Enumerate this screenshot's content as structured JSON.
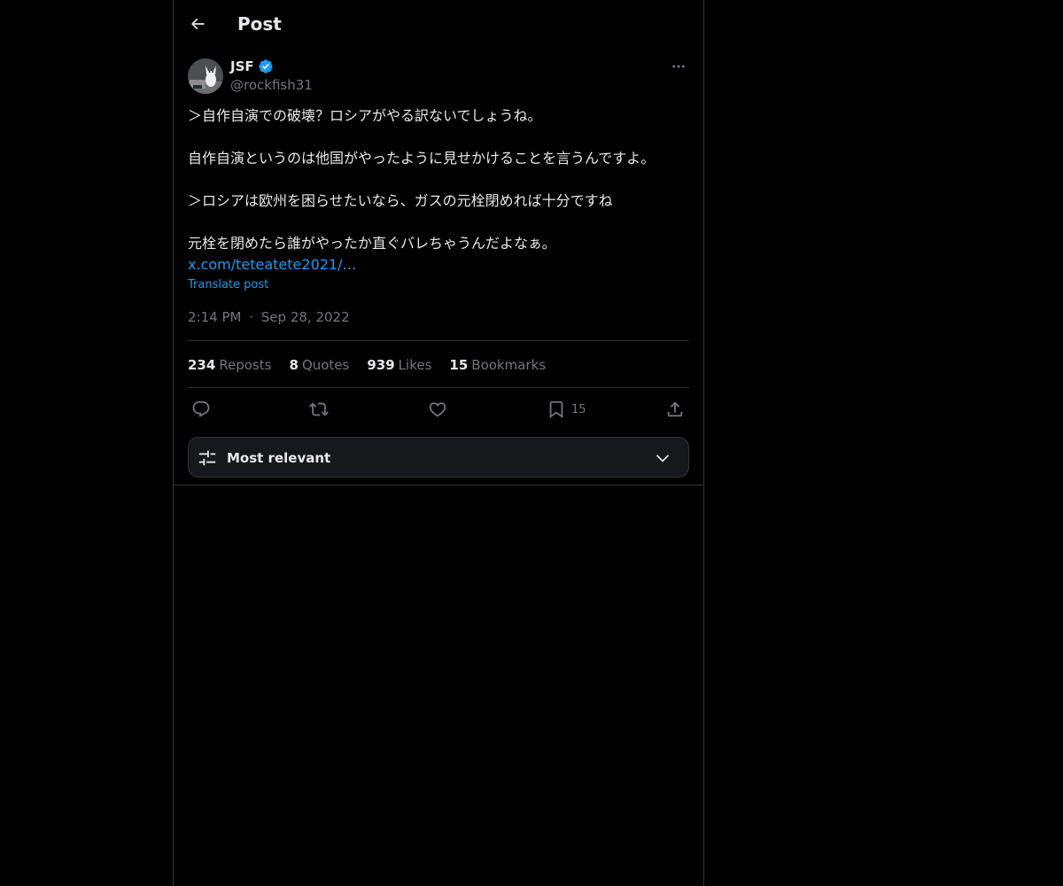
{
  "header": {
    "title": "Post",
    "back_icon": "arrow-left-icon"
  },
  "author": {
    "display_name": "JSF",
    "handle": "@rockfish31",
    "verified": true,
    "verified_color": "#1d9bf0",
    "avatar_icon": "cat-avatar"
  },
  "tweet": {
    "paragraphs": [
      "＞自作自演での破壊？ロシアがやる訳ないでしょうね。",
      "自作自演というのは他国がやったように見せかけることを言うんですよ。",
      "＞ロシアは欧州を困らせたいなら、ガスの元栓閉めれば十分ですね",
      "元栓を閉めたら誰がやったか直ぐバレちゃうんだよなぁ。"
    ],
    "link": "x.com/teteatete2021/…",
    "translate_label": "Translate post",
    "time": "2:14 PM",
    "separator": "·",
    "date": "Sep 28, 2022"
  },
  "stats": {
    "reposts": {
      "count": "234",
      "label": "Reposts"
    },
    "quotes": {
      "count": "8",
      "label": "Quotes"
    },
    "likes": {
      "count": "939",
      "label": "Likes"
    },
    "bookmarks": {
      "count": "15",
      "label": "Bookmarks"
    }
  },
  "actions": {
    "reply_icon": "reply-icon",
    "repost_icon": "repost-icon",
    "like_icon": "heart-icon",
    "bookmark_icon": "bookmark-icon",
    "bookmark_count": "15",
    "share_icon": "share-icon"
  },
  "sort": {
    "label": "Most relevant",
    "icon": "sliders-icon"
  },
  "colors": {
    "background": "#000000",
    "text": "#e7e9ea",
    "muted": "#71767b",
    "accent": "#1d9bf0",
    "border": "#2f3336"
  }
}
